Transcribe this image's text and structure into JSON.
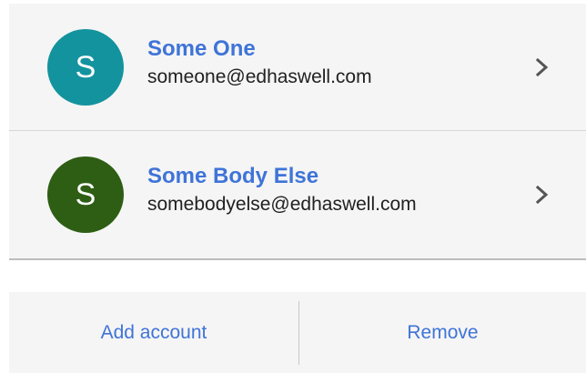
{
  "accounts": [
    {
      "initial": "S",
      "name": "Some One",
      "email": "someone@edhaswell.com",
      "avatar_color": "#13939e",
      "icon": "chevron-right-icon"
    },
    {
      "initial": "S",
      "name": "Some Body Else",
      "email": "somebodyelse@edhaswell.com",
      "avatar_color": "#2d5e14",
      "icon": "chevron-right-icon"
    }
  ],
  "actions": {
    "add_label": "Add account",
    "remove_label": "Remove"
  },
  "colors": {
    "link": "#3f74d8",
    "card_background": "#f5f5f5",
    "chevron": "#555555"
  }
}
